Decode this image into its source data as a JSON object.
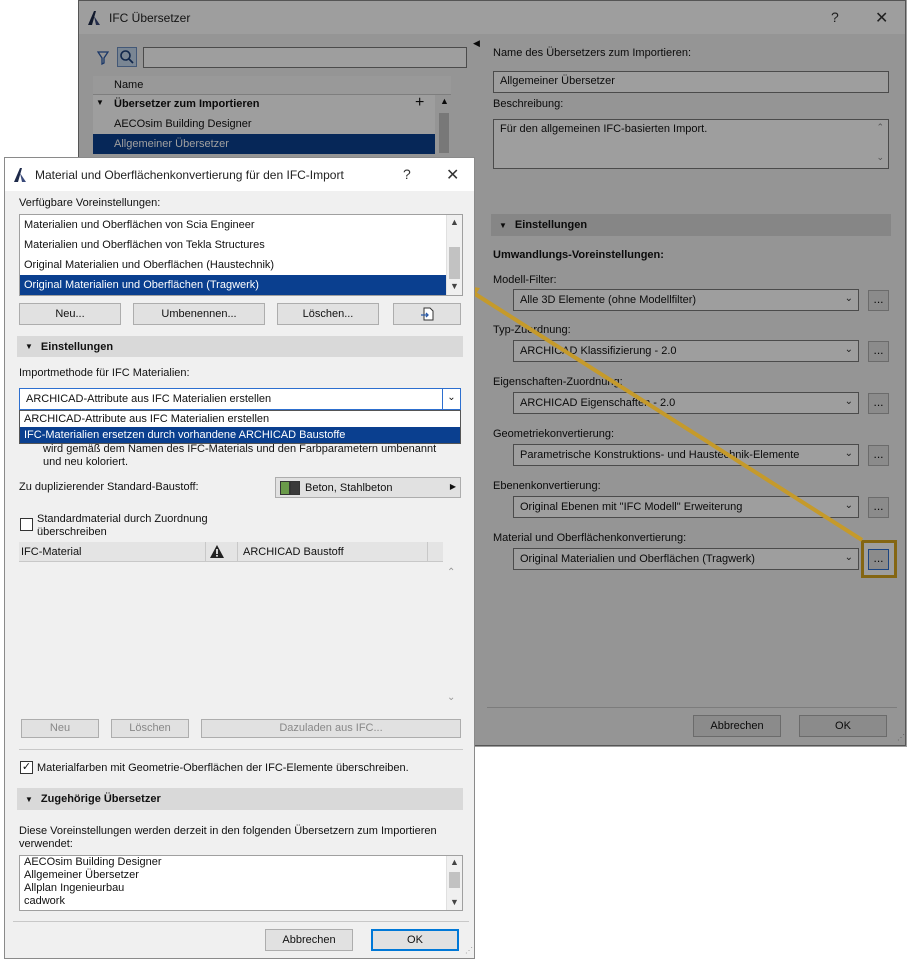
{
  "back_window": {
    "title": "IFC Übersetzer",
    "help": "?",
    "close": "✕",
    "tree": {
      "col_name": "Name",
      "group": "Übersetzer zum Importieren",
      "items": [
        "AECOsim Building Designer",
        "Allgemeiner Übersetzer"
      ]
    },
    "name_label": "Name des Übersetzers zum Importieren:",
    "name_value": "Allgemeiner Übersetzer",
    "desc_label": "Beschreibung:",
    "desc_value": "Für den allgemeinen IFC-basierten Import.",
    "settings_header": "Einstellungen",
    "presets_label": "Umwandlungs-Voreinstellungen:",
    "rows": [
      {
        "label": "Modell-Filter:",
        "value": "Alle 3D Elemente (ohne Modellfilter)"
      },
      {
        "label": "Typ-Zuordnung:",
        "value": "ARCHICAD Klassifizierung - 2.0"
      },
      {
        "label": "Eigenschaften-Zuordnung:",
        "value": "ARCHICAD Eigenschaften - 2.0"
      },
      {
        "label": "Geometriekonvertierung:",
        "value": "Parametrische Konstruktions- und Haustechnik-Elemente"
      },
      {
        "label": "Ebenenkonvertierung:",
        "value": "Original Ebenen mit \"IFC Modell\" Erweiterung"
      },
      {
        "label": "Material und Oberflächenkonvertierung:",
        "value": "Original Materialien und Oberflächen (Tragwerk)"
      }
    ],
    "dots": "...",
    "cancel": "Abbrechen",
    "ok": "OK"
  },
  "front_window": {
    "title": "Material und Oberflächenkonvertierung für den IFC-Import",
    "help": "?",
    "close": "✕",
    "available_label": "Verfügbare Voreinstellungen:",
    "presets": [
      "Materialien und Oberflächen von Scia Engineer",
      "Materialien und Oberflächen von Tekla Structures",
      "Original Materialien und Oberflächen (Haustechnik)",
      "Original Materialien und Oberflächen (Tragwerk)"
    ],
    "btn_new": "Neu...",
    "btn_rename": "Umbenennen...",
    "btn_delete": "Löschen...",
    "settings_header": "Einstellungen",
    "import_method_label": "Importmethode für IFC Materialien:",
    "import_method_value": "ARCHICAD-Attribute aus IFC Materialien erstellen",
    "dropdown_options": [
      "ARCHICAD-Attribute aus IFC Materialien erstellen",
      "IFC-Materialien ersetzen durch vorhandene ARCHICAD Baustoffe"
    ],
    "hidden_text_1": "wird gemäß dem Namen des IFC-Materials und den Farbparametern umbenannt",
    "hidden_text_2": "und neu koloriert.",
    "dup_label": "Zu duplizierender Standard-Baustoff:",
    "dup_value": "Beton, Stahlbeton",
    "override_label_1": "Standardmaterial durch Zuordnung",
    "override_label_2": "überschreiben",
    "table_col1": "IFC-Material",
    "table_col2": "ARCHICAD Baustoff",
    "btn_tbl_new": "Neu",
    "btn_tbl_delete": "Löschen",
    "btn_tbl_load": "Dazuladen aus IFC...",
    "overwrite_colors": "Materialfarben mit Geometrie-Oberflächen der IFC-Elemente überschreiben.",
    "related_header": "Zugehörige Übersetzer",
    "related_desc_1": "Diese Voreinstellungen werden derzeit in den folgenden Übersetzern zum Importieren",
    "related_desc_2": "verwendet:",
    "related_list": [
      "AECOsim Building Designer",
      "Allgemeiner Übersetzer",
      "Allplan Ingenieurbau",
      "cadwork"
    ],
    "cancel": "Abbrechen",
    "ok": "OK"
  },
  "colors": {
    "selection": "#0a3f8f",
    "highlight": "#d6a520",
    "arrow": "#c59a2b"
  }
}
